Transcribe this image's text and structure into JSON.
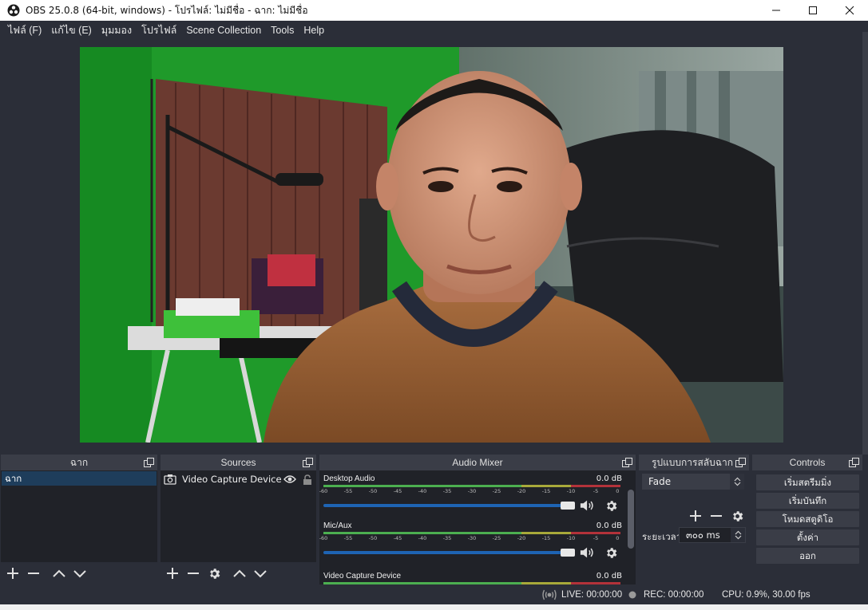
{
  "window": {
    "title": "OBS 25.0.8 (64-bit, windows) - โปรไฟล์: ไม่มีชื่อ - ฉาก: ไม่มีชื่อ"
  },
  "menu": {
    "items": [
      "ไฟล์ (F)",
      "แก้ไข (E)",
      "มุมมอง",
      "โปรไฟล์",
      "Scene Collection",
      "Tools",
      "Help"
    ]
  },
  "scenes": {
    "title": "ฉาก",
    "items": [
      "ฉาก"
    ]
  },
  "sources": {
    "title": "Sources",
    "items": [
      {
        "name": "Video Capture Device",
        "icon": "camera-icon"
      }
    ]
  },
  "mixer": {
    "title": "Audio Mixer",
    "ticks": [
      "-60",
      "-55",
      "-50",
      "-45",
      "-40",
      "-35",
      "-30",
      "-25",
      "-20",
      "-15",
      "-10",
      "-5",
      "0"
    ],
    "channels": [
      {
        "name": "Desktop Audio",
        "db": "0.0 dB",
        "volume": 1.0
      },
      {
        "name": "Mic/Aux",
        "db": "0.0 dB",
        "volume": 1.0
      },
      {
        "name": "Video Capture Device",
        "db": "0.0 dB",
        "volume": 1.0
      }
    ]
  },
  "transitions": {
    "title": "รูปแบบการสลับฉาก",
    "selected": "Fade",
    "duration_label": "ระยะเวลา",
    "duration_value": "๓๐๐ ms"
  },
  "controls": {
    "title": "Controls",
    "buttons": [
      "เริ่มสตรีมมิ่ง",
      "เริ่มบันทึก",
      "โหมดสตูดิโอ",
      "ตั้งค่า",
      "ออก"
    ]
  },
  "status": {
    "live": "LIVE: 00:00:00",
    "rec": "REC: 00:00:00",
    "cpu": "CPU: 0.9%, 30.00 fps"
  },
  "colors": {
    "accent": "#1e64b4",
    "background": "#2b2e38",
    "dock_background": "#202228",
    "meter_green": "#4caf50",
    "meter_yellow": "#a8a93a",
    "meter_red": "#b3323a"
  }
}
